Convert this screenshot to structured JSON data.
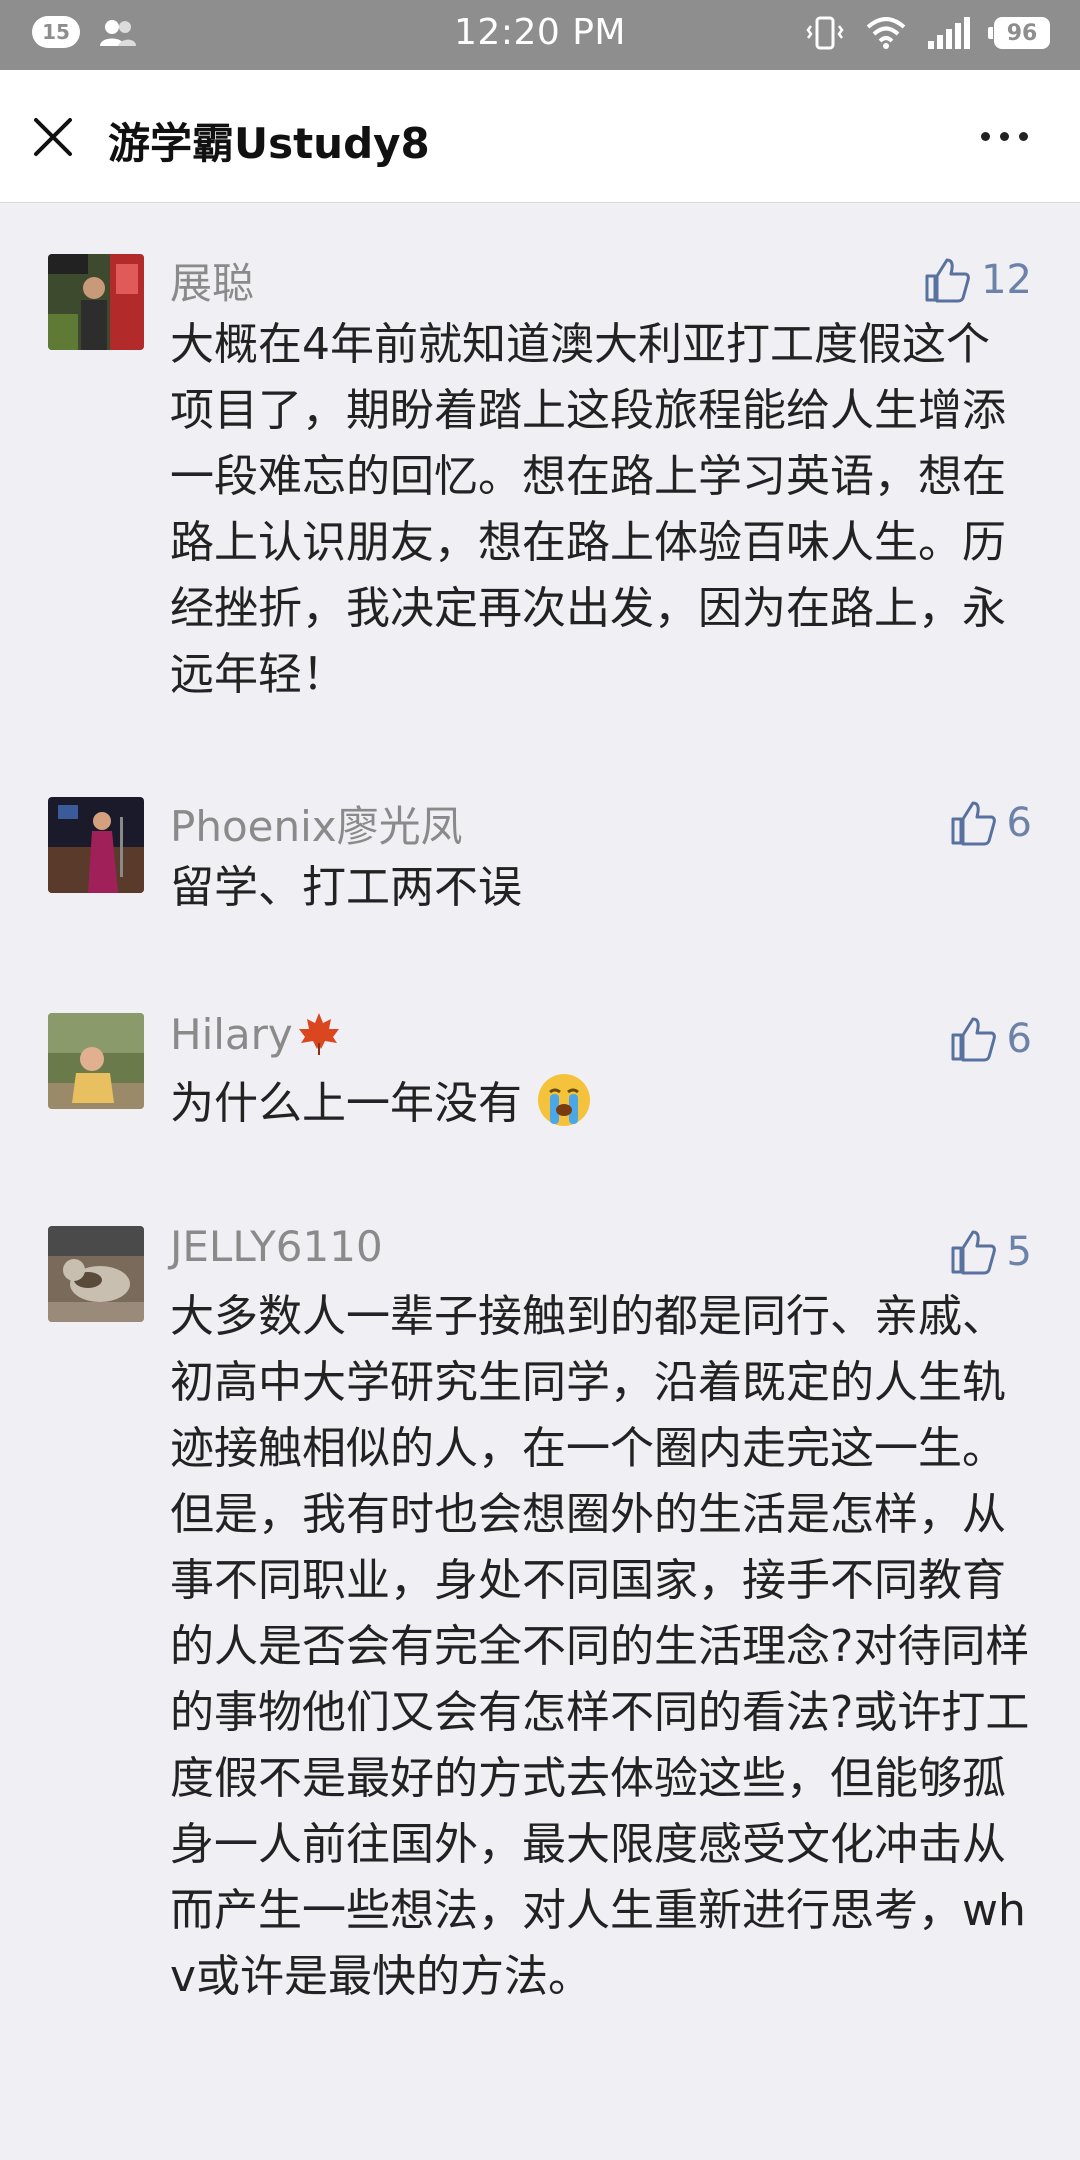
{
  "status_bar": {
    "notification_count": "15",
    "time": "12:20 PM",
    "battery": "96"
  },
  "nav": {
    "title": "游学霸Ustudy8"
  },
  "comments": [
    {
      "author": "展聪",
      "likes": "12",
      "text": "大概在4年前就知道澳大利亚打工度假这个项目了，期盼着踏上这段旅程能给人生增添一段难忘的回忆。想在路上学习英语，想在路上认识朋友，想在路上体验百味人生。历经挫折，我决定再次出发，因为在路上，永远年轻！"
    },
    {
      "author": "Phoenix廖光凤",
      "likes": "6",
      "text": "留学、打工两不误"
    },
    {
      "author": "Hilary",
      "author_emoji": "maple-leaf",
      "likes": "6",
      "text": "为什么上一年没有",
      "text_emoji": "crying-face"
    },
    {
      "author": "JELLY6110",
      "likes": "5",
      "text": "大多数人一辈子接触到的都是同行、亲戚、初高中大学研究生同学，沿着既定的人生轨迹接触相似的人，在一个圈内走完这一生。但是，我有时也会想圈外的生活是怎样，从事不同职业，身处不同国家，接手不同教育的人是否会有完全不同的生活理念?对待同样的事物他们又会有怎样不同的看法?或许打工度假不是最好的方式去体验这些，但能够孤身一人前往国外，最大限度感受文化冲击从而产生一些想法，对人生重新进行思考，whv或许是最快的方法。"
    }
  ],
  "colors": {
    "status_bar_bg": "#8e8e8e",
    "page_bg": "#efeff4",
    "like_icon": "#59719e",
    "author_text": "#8a8a8a"
  },
  "icons": [
    "close-icon",
    "more-icon",
    "vibrate-icon",
    "wifi-icon",
    "signal-icon",
    "battery-icon",
    "thumb-up-icon",
    "maple-leaf-icon",
    "crying-face-icon"
  ]
}
